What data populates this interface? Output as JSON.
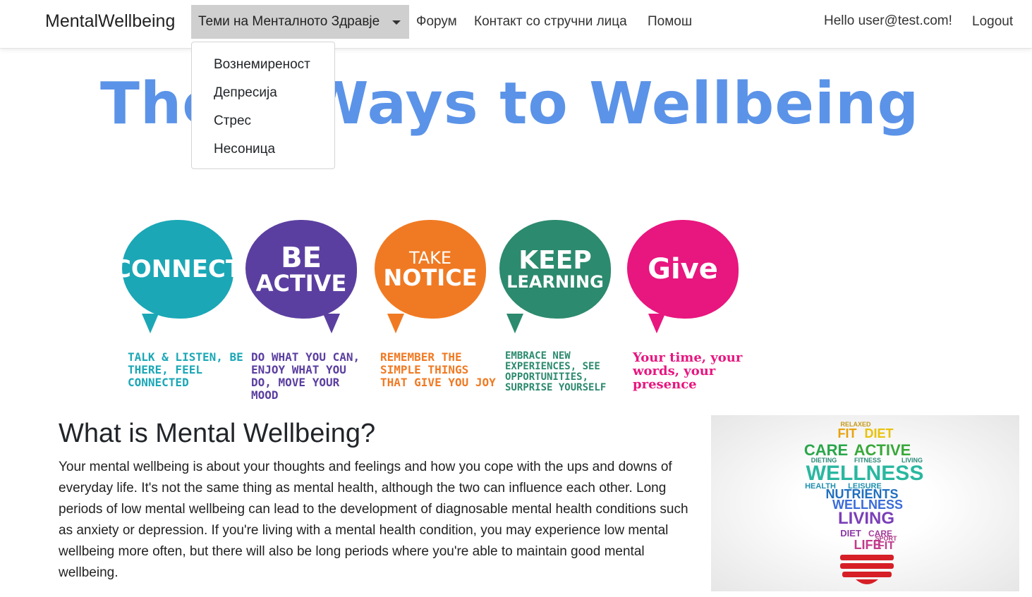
{
  "navbar": {
    "brand": "MentalWellbeing",
    "dropdown_label": "Теми на Менталното Здравје",
    "dropdown_items": [
      "Вознемиреност",
      "Депресија",
      "Стрес",
      "Несоница"
    ],
    "links": [
      "Форум",
      "Контакт со стручни лица",
      "Помош"
    ],
    "greeting": "Hello user@test.com!",
    "logout": "Logout"
  },
  "banner": {
    "title": "The 5 Ways to Wellbeing",
    "ways": [
      {
        "word1": "CONNECT",
        "word2": "",
        "color": "#1ba7b6",
        "caption": "Talk & listen, be there, feel connected"
      },
      {
        "word1": "BE",
        "word2": "ACTIVE",
        "color": "#5b3fa0",
        "caption": "Do what you can, enjoy what you do, move your mood"
      },
      {
        "word1": "TAKE",
        "word2": "NOTICE",
        "color": "#f07a23",
        "caption": "Remember the simple things that give you joy"
      },
      {
        "word1": "KEEP",
        "word2": "LEARNING",
        "color": "#2c8a6e",
        "caption": "Embrace new experiences, see opportunities, surprise yourself"
      },
      {
        "word1": "Give",
        "word2": "",
        "color": "#e8167f",
        "caption": "Your time, your words, your presence"
      }
    ]
  },
  "content": {
    "heading": "What is Mental Wellbeing?",
    "paragraph": "Your mental wellbeing is about your thoughts and feelings and how you cope with the ups and downs of everyday life. It's not the same thing as mental health, although the two can influence each other. Long periods of low mental wellbeing can lead to the development of diagnosable mental health conditions such as anxiety or depression. If you're living with a mental health condition, you may experience low mental wellbeing more often, but there will also be long periods where you're able to maintain good mental wellbeing."
  },
  "wordcloud": {
    "words": [
      "FIT",
      "DIET",
      "CARE",
      "ACTIVE",
      "RELAXED",
      "DIETING",
      "FITNESS",
      "LIVING",
      "WELLNESS",
      "HEALTH",
      "LEISURE",
      "NUTRIENTS",
      "WELLNESS",
      "LIVING",
      "DIET",
      "CARE",
      "LIFE",
      "FIT",
      "SPORT"
    ]
  }
}
